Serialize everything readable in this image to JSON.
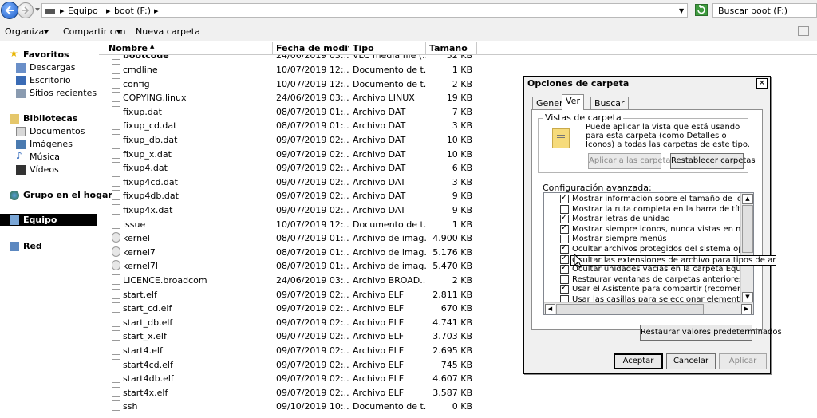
{
  "address": {
    "breadcrumbs": [
      "Equipo",
      "boot (F:)"
    ],
    "search_placeholder": "Buscar boot (F:)"
  },
  "toolbar": {
    "organize": "Organizar",
    "share": "Compartir con",
    "new_folder": "Nueva carpeta"
  },
  "sidebar": {
    "favorites": "Favoritos",
    "downloads": "Descargas",
    "desktop": "Escritorio",
    "recent": "Sitios recientes",
    "libraries": "Bibliotecas",
    "documents": "Documentos",
    "images": "Imágenes",
    "music": "Música",
    "videos": "Vídeos",
    "homegroup": "Grupo en el hogar",
    "computer": "Equipo",
    "network": "Red"
  },
  "columns": {
    "name": "Nombre",
    "date": "Fecha de modific...",
    "type": "Tipo",
    "size": "Tamaño"
  },
  "files": [
    {
      "name": "cmdline",
      "date": "10/07/2019 12:...",
      "type": "Documento de t...",
      "size": "1 KB",
      "icon": "file-icon"
    },
    {
      "name": "config",
      "date": "10/07/2019 12:...",
      "type": "Documento de t...",
      "size": "2 KB",
      "icon": "file-icon"
    },
    {
      "name": "COPYING.linux",
      "date": "24/06/2019 03:...",
      "type": "Archivo LINUX",
      "size": "19 KB",
      "icon": "file-icon"
    },
    {
      "name": "fixup.dat",
      "date": "08/07/2019 01:...",
      "type": "Archivo DAT",
      "size": "7 KB",
      "icon": "file-icon"
    },
    {
      "name": "fixup_cd.dat",
      "date": "08/07/2019 01:...",
      "type": "Archivo DAT",
      "size": "3 KB",
      "icon": "file-icon"
    },
    {
      "name": "fixup_db.dat",
      "date": "09/07/2019 02:...",
      "type": "Archivo DAT",
      "size": "10 KB",
      "icon": "file-icon"
    },
    {
      "name": "fixup_x.dat",
      "date": "09/07/2019 02:...",
      "type": "Archivo DAT",
      "size": "10 KB",
      "icon": "file-icon"
    },
    {
      "name": "fixup4.dat",
      "date": "09/07/2019 02:...",
      "type": "Archivo DAT",
      "size": "6 KB",
      "icon": "file-icon"
    },
    {
      "name": "fixup4cd.dat",
      "date": "09/07/2019 02:...",
      "type": "Archivo DAT",
      "size": "3 KB",
      "icon": "file-icon"
    },
    {
      "name": "fixup4db.dat",
      "date": "09/07/2019 02:...",
      "type": "Archivo DAT",
      "size": "9 KB",
      "icon": "file-icon"
    },
    {
      "name": "fixup4x.dat",
      "date": "09/07/2019 02:...",
      "type": "Archivo DAT",
      "size": "9 KB",
      "icon": "file-icon"
    },
    {
      "name": "issue",
      "date": "10/07/2019 12:...",
      "type": "Documento de t...",
      "size": "1 KB",
      "icon": "file-icon"
    },
    {
      "name": "kernel",
      "date": "08/07/2019 01:...",
      "type": "Archivo de imag...",
      "size": "4.900 KB",
      "icon": "disk-image-icon"
    },
    {
      "name": "kernel7",
      "date": "08/07/2019 01:...",
      "type": "Archivo de imag...",
      "size": "5.176 KB",
      "icon": "disk-image-icon"
    },
    {
      "name": "kernel7l",
      "date": "08/07/2019 01:...",
      "type": "Archivo de imag...",
      "size": "5.470 KB",
      "icon": "disk-image-icon"
    },
    {
      "name": "LICENCE.broadcom",
      "date": "24/06/2019 03:...",
      "type": "Archivo BROAD...",
      "size": "2 KB",
      "icon": "file-icon"
    },
    {
      "name": "start.elf",
      "date": "09/07/2019 02:...",
      "type": "Archivo ELF",
      "size": "2.811 KB",
      "icon": "file-icon"
    },
    {
      "name": "start_cd.elf",
      "date": "09/07/2019 02:...",
      "type": "Archivo ELF",
      "size": "670 KB",
      "icon": "file-icon"
    },
    {
      "name": "start_db.elf",
      "date": "09/07/2019 02:...",
      "type": "Archivo ELF",
      "size": "4.741 KB",
      "icon": "file-icon"
    },
    {
      "name": "start_x.elf",
      "date": "09/07/2019 02:...",
      "type": "Archivo ELF",
      "size": "3.703 KB",
      "icon": "file-icon"
    },
    {
      "name": "start4.elf",
      "date": "09/07/2019 02:...",
      "type": "Archivo ELF",
      "size": "2.695 KB",
      "icon": "file-icon"
    },
    {
      "name": "start4cd.elf",
      "date": "09/07/2019 02:...",
      "type": "Archivo ELF",
      "size": "745 KB",
      "icon": "file-icon"
    },
    {
      "name": "start4db.elf",
      "date": "09/07/2019 02:...",
      "type": "Archivo ELF",
      "size": "4.607 KB",
      "icon": "file-icon"
    },
    {
      "name": "start4x.elf",
      "date": "09/07/2019 02:...",
      "type": "Archivo ELF",
      "size": "3.587 KB",
      "icon": "file-icon"
    },
    {
      "name": "ssh",
      "date": "09/10/2019 10:...",
      "type": "Documento de t...",
      "size": "0 KB",
      "icon": "file-icon"
    }
  ],
  "dialog": {
    "title": "Opciones de carpeta",
    "tabs": [
      "General",
      "Ver",
      "Buscar"
    ],
    "active_tab": "Ver",
    "group_title": "Vistas de carpeta",
    "group_desc": "Puede aplicar la vista que está usando para esta carpeta (como Detalles o Iconos) a todas las carpetas de este tipo.",
    "apply_folders": "Aplicar a las carpetas",
    "reset_folders": "Restablecer carpetas",
    "advanced_label": "Configuración avanzada:",
    "options": [
      {
        "label": "Mostrar información sobre el tamaño de los archivos en s",
        "checked": true
      },
      {
        "label": "Mostrar la ruta completa en la barra de título (sólo el tema",
        "checked": false
      },
      {
        "label": "Mostrar letras de unidad",
        "checked": true
      },
      {
        "label": "Mostrar siempre iconos, nunca vistas en miniatura",
        "checked": true
      },
      {
        "label": "Mostrar siempre menús",
        "checked": false
      },
      {
        "label": "Ocultar archivos protegidos del sistema operativo (recom",
        "checked": true
      },
      {
        "label": "Ocultar las extensiones de archivo para tipos de archivo conocidos",
        "checked": true
      },
      {
        "label": "Ocultar unidades vacías en la carpeta Equipo",
        "checked": true
      },
      {
        "label": "Restaurar ventanas de carpetas anteriores al iniciar sesió",
        "checked": false
      },
      {
        "label": "Usar el Asistente para compartir (recomendado)",
        "checked": true
      },
      {
        "label": "Usar las casillas para seleccionar elementos",
        "checked": false
      }
    ],
    "tooltip": "Ocultar las extensiones de archivo para tipos de archivo conocidos",
    "restore_defaults": "Restaurar valores predeterminados",
    "ok": "Aceptar",
    "cancel": "Cancelar",
    "apply": "Aplicar"
  }
}
